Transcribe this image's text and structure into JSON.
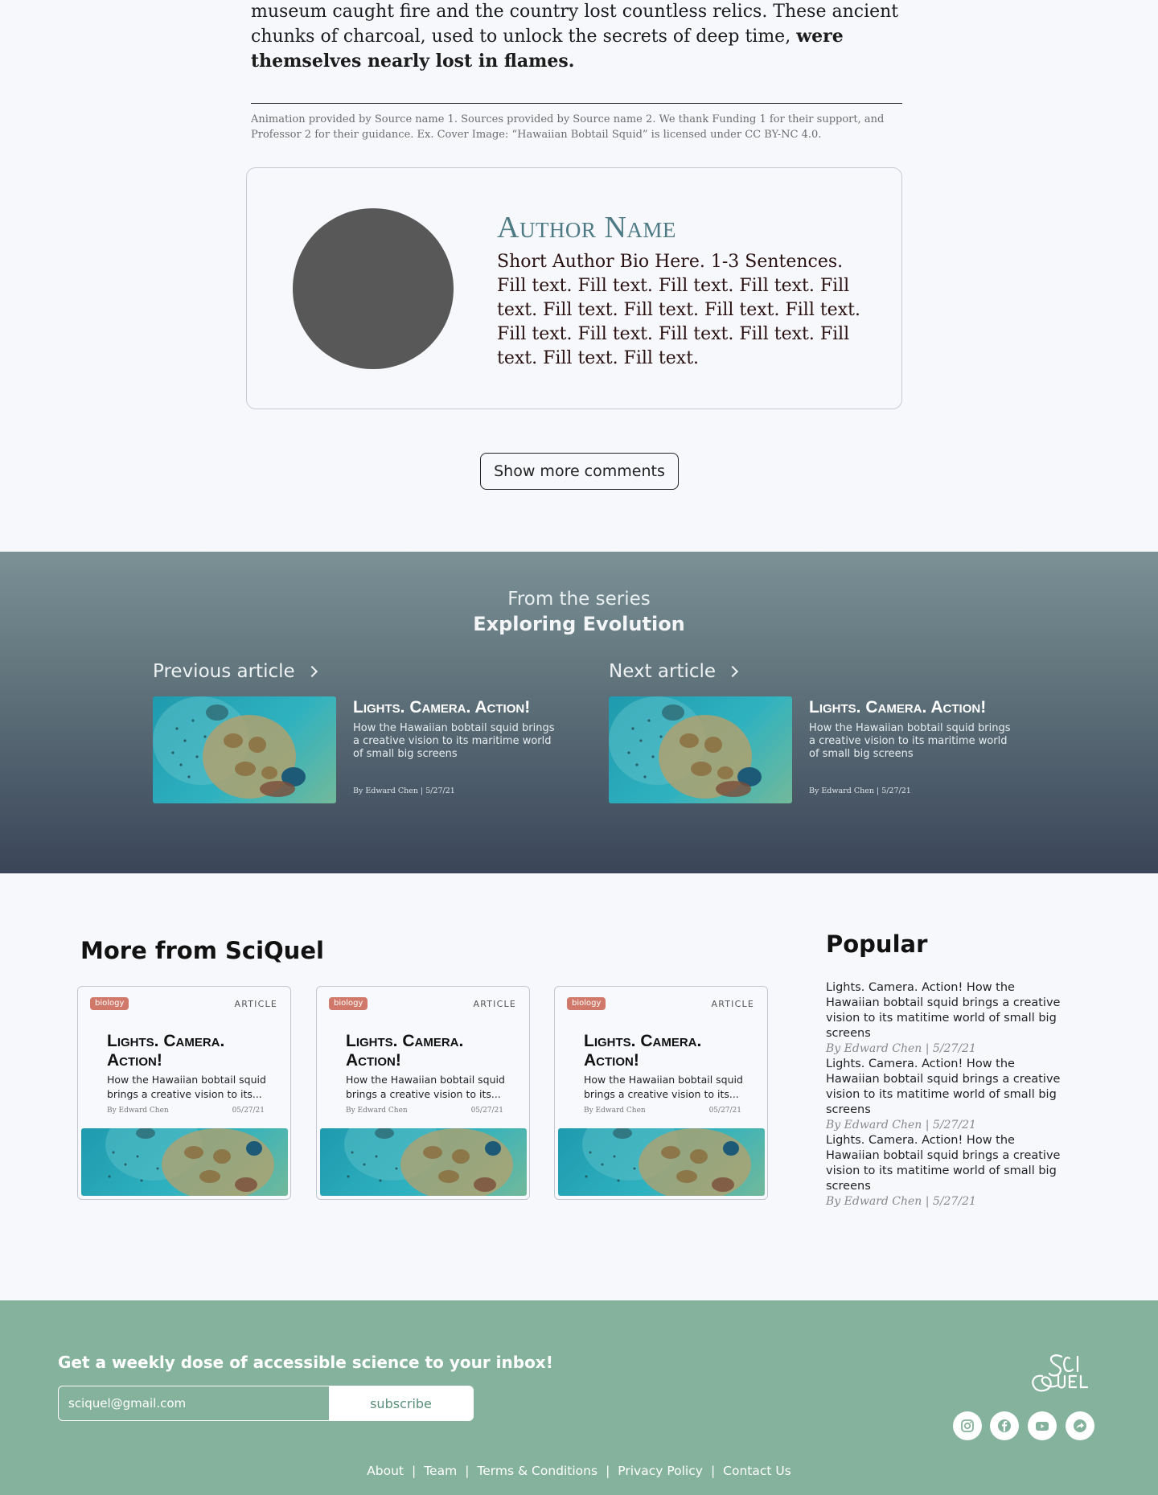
{
  "article": {
    "end_line_1": "museum caught fire and the country lost countless relics. These ancient",
    "end_line_2": "chunks of charcoal, used to unlock the secrets of deep time, ",
    "end_bold": "were themselves nearly lost in flames.",
    "credits": "Animation provided by Source name 1. Sources provided by Source name 2. We thank Funding 1 for their support, and Professor 2 for their guidance. Ex. Cover Image: “Hawaiian Bobtail Squid” is licensed under CC BY-NC 4.0."
  },
  "author": {
    "name": "Author Name",
    "bio": "Short Author Bio Here. 1-3 Sentences. Fill text. Fill text. Fill text. Fill text. Fill text. Fill text. Fill text. Fill text. Fill text. Fill text. Fill text. Fill text. Fill text. Fill text. Fill text. Fill text."
  },
  "comments": {
    "show_more_label": "Show more comments"
  },
  "series": {
    "kicker": "From the series",
    "title": "Exploring Evolution",
    "previous": {
      "heading": "Previous article",
      "title": "Lights. Camera. Action!",
      "desc": "How the Hawaiian bobtail squid brings a creative vision to its maritime world of small big screens",
      "byline": "By Edward Chen | 5/27/21"
    },
    "next": {
      "heading": "Next article",
      "title": "Lights. Camera. Action!",
      "desc": "How the Hawaiian bobtail squid brings a creative vision to its maritime world of small big screens",
      "byline": "By Edward Chen | 5/27/21"
    }
  },
  "more": {
    "title": "More from SciQuel",
    "cards": [
      {
        "tag": "biology",
        "type": "ARTICLE",
        "title": "Lights. Camera. Action!",
        "desc": "How the Hawaiian bobtail squid brings a creative vision to its...",
        "author": "By Edward Chen",
        "date": "05/27/21"
      },
      {
        "tag": "biology",
        "type": "ARTICLE",
        "title": "Lights. Camera. Action!",
        "desc": "How the Hawaiian bobtail squid brings a creative vision to its...",
        "author": "By Edward Chen",
        "date": "05/27/21"
      },
      {
        "tag": "biology",
        "type": "ARTICLE",
        "title": "Lights. Camera. Action!",
        "desc": "How the Hawaiian bobtail squid brings a creative vision to its...",
        "author": "By Edward Chen",
        "date": "05/27/21"
      }
    ]
  },
  "popular": {
    "title": "Popular",
    "items": [
      {
        "text": "Lights. Camera. Action! How the Hawaiian bobtail squid brings a creative vision to its matitime world of small big screens",
        "byline": "By Edward Chen | 5/27/21"
      },
      {
        "text": "Lights. Camera. Action! How the Hawaiian bobtail squid brings a creative vision to its matitime world of small big screens",
        "byline": "By Edward Chen | 5/27/21"
      },
      {
        "text": "Lights. Camera. Action! How the Hawaiian bobtail squid brings a creative vision to its matitime world of small big screens",
        "byline": "By Edward Chen | 5/27/21"
      }
    ]
  },
  "footer": {
    "cta": "Get a weekly dose of accessible science to your inbox!",
    "email_value": "sciquel@gmail.com",
    "subscribe_label": "subscribe",
    "logo_text": "SciQuel",
    "social": [
      "instagram-icon",
      "facebook-icon",
      "youtube-icon",
      "share-icon"
    ],
    "links": [
      "About",
      "Team",
      "Terms & Conditions",
      "Privacy Policy",
      "Contact Us"
    ]
  },
  "colors": {
    "author_name": "#4e7a85",
    "tag": "#d0786a",
    "footer_bg": "#85b29d",
    "series_top": "#7b9196",
    "series_bottom": "#3a4558"
  }
}
